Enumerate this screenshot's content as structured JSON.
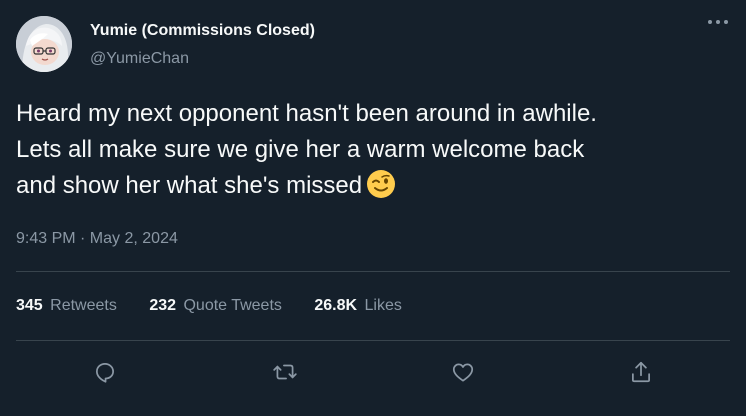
{
  "author": {
    "name": "Yumie (Commissions Closed)",
    "handle": "@YumieChan"
  },
  "tweet": {
    "lines": [
      "Heard my next opponent hasn't been around in awhile.",
      "Lets all make sure we give her a warm welcome back",
      "and show her what she's missed"
    ],
    "emoji": "winking-face",
    "timestamp": "9:43 PM · May 2, 2024"
  },
  "stats": {
    "retweets_count": "345",
    "retweets_label": "Retweets",
    "quotes_count": "232",
    "quotes_label": "Quote Tweets",
    "likes_count": "26.8K",
    "likes_label": "Likes"
  },
  "more_icon": "more-horizontal-icon",
  "actions": [
    "reply-icon",
    "retweet-icon",
    "like-icon",
    "share-icon"
  ],
  "colors": {
    "background": "#15202b",
    "text": "#f7f9f9",
    "secondary_text": "#8b98a5",
    "divider": "#38444d"
  }
}
